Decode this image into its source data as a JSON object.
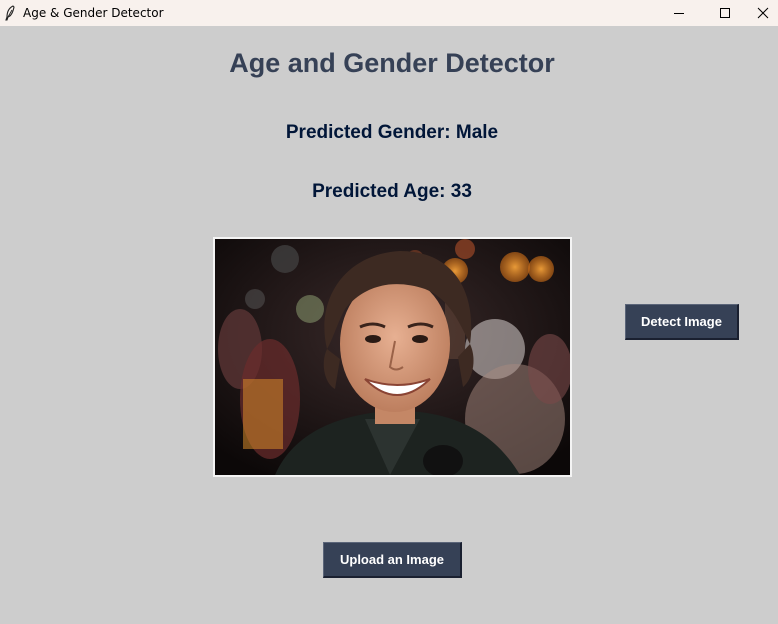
{
  "window": {
    "title": "Age & Gender Detector",
    "icon": "feather-icon"
  },
  "main": {
    "heading": "Age and Gender Detector",
    "predicted_gender": "Predicted Gender: Male",
    "predicted_age": "Predicted Age: 33",
    "image_description_icon": "uploaded-photo"
  },
  "buttons": {
    "detect_label": "Detect Image",
    "upload_label": "Upload an Image"
  },
  "colors": {
    "background": "#cdcdcd",
    "heading": "#364156",
    "labels": "#011638",
    "button_bg": "#364156",
    "button_text": "#ffffff",
    "titlebar": "#f8f1ed"
  }
}
